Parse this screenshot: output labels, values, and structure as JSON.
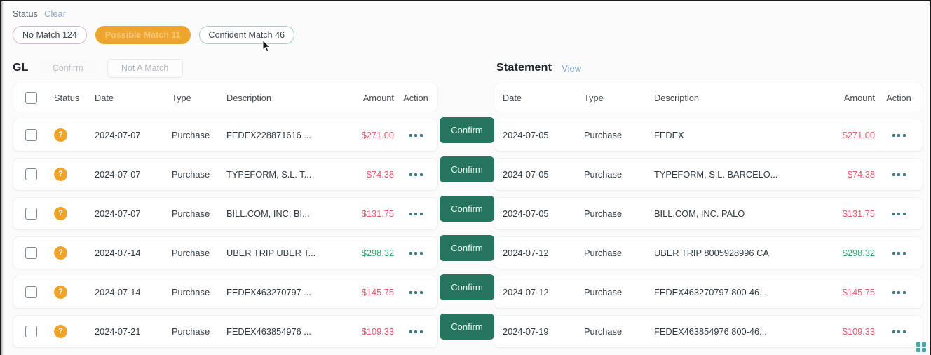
{
  "filters": {
    "label": "Status",
    "clear_label": "Clear",
    "chips": [
      {
        "label": "No Match",
        "count": "124",
        "state": "nomatch"
      },
      {
        "label": "Possible Match",
        "count": "11",
        "state": "possible"
      },
      {
        "label": "Confident Match",
        "count": "46",
        "state": "confident"
      }
    ]
  },
  "gl": {
    "title": "GL",
    "confirm_label": "Confirm",
    "not_a_match_label": "Not A Match",
    "columns": {
      "status": "Status",
      "date": "Date",
      "type": "Type",
      "description": "Description",
      "amount": "Amount",
      "action": "Action"
    },
    "rows": [
      {
        "status_icon": "?",
        "date": "2024-07-07",
        "type": "Purchase",
        "description": "FEDEX228871616 ...",
        "amount": "$271.00",
        "amount_sign": "neg"
      },
      {
        "status_icon": "?",
        "date": "2024-07-07",
        "type": "Purchase",
        "description": "TYPEFORM, S.L. T...",
        "amount": "$74.38",
        "amount_sign": "neg"
      },
      {
        "status_icon": "?",
        "date": "2024-07-07",
        "type": "Purchase",
        "description": "BILL.COM, INC. BI...",
        "amount": "$131.75",
        "amount_sign": "neg"
      },
      {
        "status_icon": "?",
        "date": "2024-07-14",
        "type": "Purchase",
        "description": "UBER TRIP UBER T...",
        "amount": "$298.32",
        "amount_sign": "pos"
      },
      {
        "status_icon": "?",
        "date": "2024-07-14",
        "type": "Purchase",
        "description": "FEDEX463270797 ...",
        "amount": "$145.75",
        "amount_sign": "neg"
      },
      {
        "status_icon": "?",
        "date": "2024-07-21",
        "type": "Purchase",
        "description": "FEDEX463854976 ...",
        "amount": "$109.33",
        "amount_sign": "neg"
      }
    ]
  },
  "match_column": {
    "confirm_labels": [
      "Confirm",
      "Confirm",
      "Confirm",
      "Confirm",
      "Confirm",
      "Confirm"
    ]
  },
  "statement": {
    "title": "Statement",
    "view_label": "View",
    "columns": {
      "date": "Date",
      "type": "Type",
      "description": "Description",
      "amount": "Amount",
      "action": "Action"
    },
    "rows": [
      {
        "date": "2024-07-05",
        "type": "Purchase",
        "description": "FEDEX",
        "amount": "$271.00",
        "amount_sign": "neg"
      },
      {
        "date": "2024-07-05",
        "type": "Purchase",
        "description": "TYPEFORM, S.L. BARCELO...",
        "amount": "$74.38",
        "amount_sign": "neg"
      },
      {
        "date": "2024-07-05",
        "type": "Purchase",
        "description": "BILL.COM, INC. PALO",
        "amount": "$131.75",
        "amount_sign": "neg"
      },
      {
        "date": "2024-07-12",
        "type": "Purchase",
        "description": "UBER TRIP 8005928996 CA",
        "amount": "$298.32",
        "amount_sign": "pos"
      },
      {
        "date": "2024-07-12",
        "type": "Purchase",
        "description": "FEDEX463270797 800-46...",
        "amount": "$145.75",
        "amount_sign": "neg"
      },
      {
        "date": "2024-07-19",
        "type": "Purchase",
        "description": "FEDEX463854976 800-46...",
        "amount": "$109.33",
        "amount_sign": "neg"
      }
    ]
  },
  "colors": {
    "confirm_button": "#25755f",
    "possible_match_chip": "#eda52e",
    "status_dot": "#f0a326",
    "amount_negative": "#e0596c",
    "amount_positive": "#2ea472",
    "link": "#7fa8d4",
    "resize_handle": "#48a7a4"
  }
}
